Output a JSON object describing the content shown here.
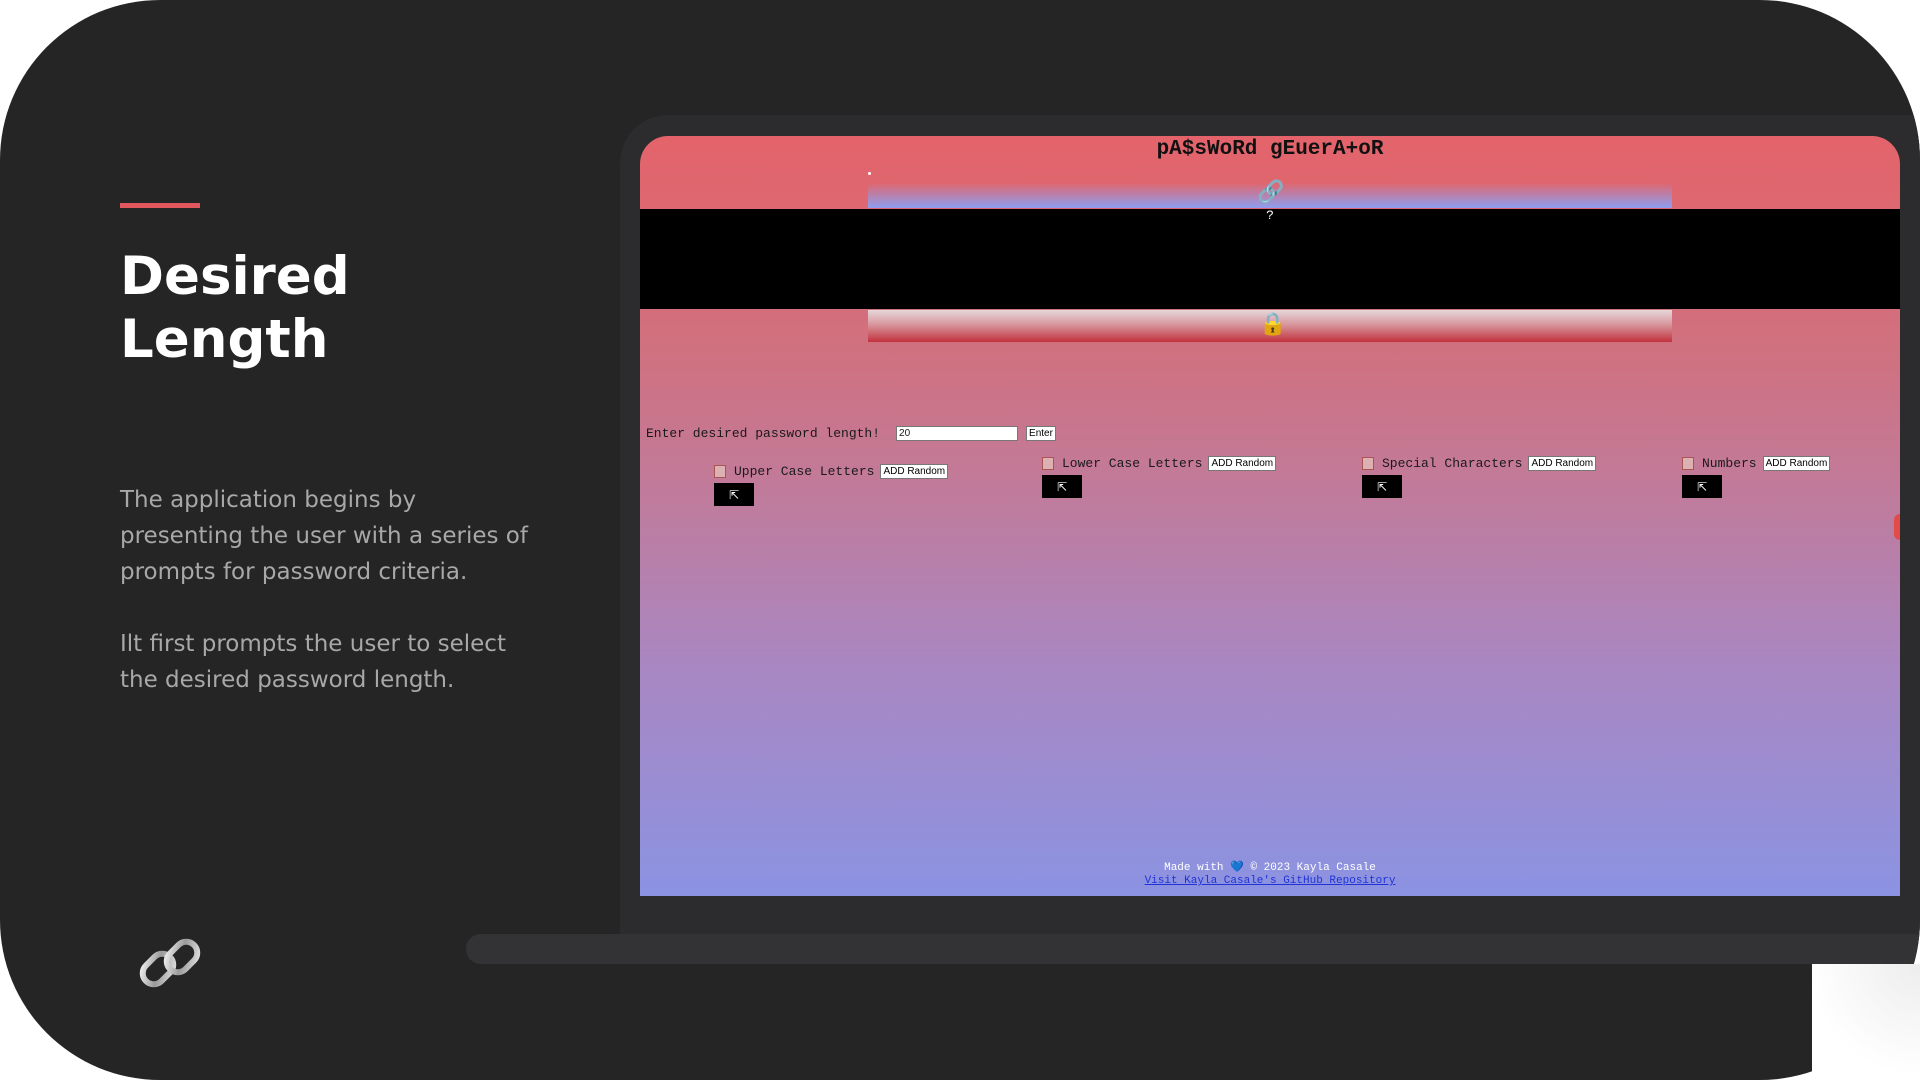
{
  "slide": {
    "heading": "Desired Length",
    "paragraph_1": "The application begins by presenting the user with a series of prompts for password criteria.",
    "paragraph_2": "Ilt first prompts the user to select the desired password length.",
    "bottom_icon": "link-icon",
    "accent_color": "#e0585e"
  },
  "app": {
    "title": "pA$sWoRd gEuerA+oR",
    "generate_icon": "link-icon",
    "output_placeholder": "?",
    "copy_icon": "lock-icon",
    "length": {
      "label": "Enter desired password length!",
      "value": "20",
      "enter_button": "Enter"
    },
    "criteria": [
      {
        "label": "Upper Case Letters",
        "button": "ADD Random",
        "toggle_glyph": "⇱"
      },
      {
        "label": "Lower Case Letters",
        "button": "ADD Random",
        "toggle_glyph": "⇱"
      },
      {
        "label": "Special Characters",
        "button": "ADD Random",
        "toggle_glyph": "⇱"
      },
      {
        "label": "Numbers",
        "button": "ADD Random",
        "toggle_glyph": "⇱"
      }
    ],
    "footer": {
      "made_with": "Made with",
      "heart": "💙",
      "copyright": "© 2023 Kayla Casale",
      "link_text": "Visit Kayla Casale's GitHub Repository"
    }
  }
}
